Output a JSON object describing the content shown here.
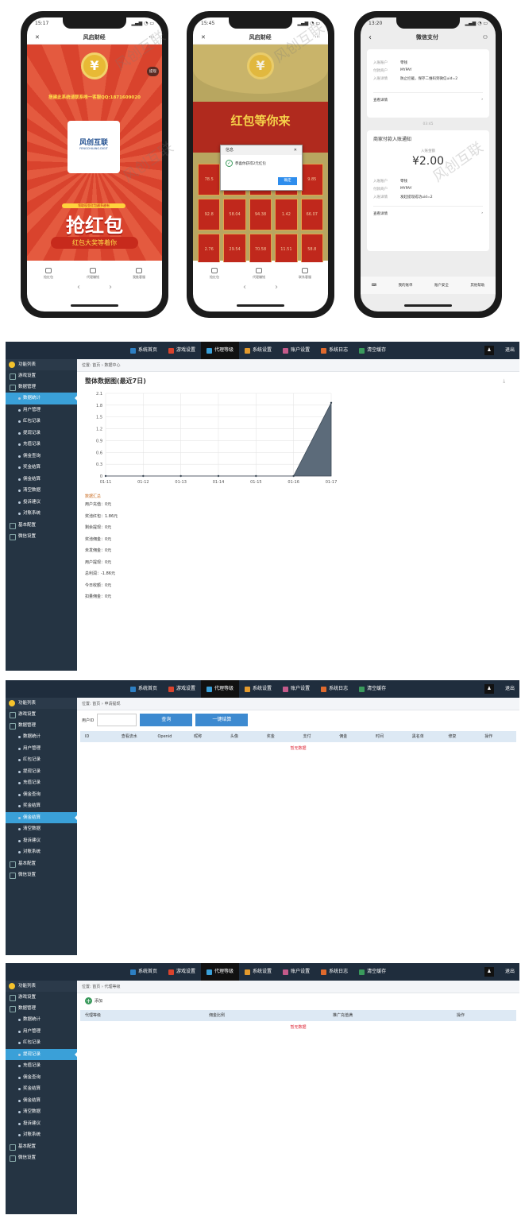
{
  "watermark": "风创互联",
  "phone1": {
    "time": "15:17",
    "title": "风启财经",
    "close": "✕",
    "more": "···",
    "coin": "¥",
    "withdraw_badge": "提现",
    "contact": "搭建此系统请联系唯一客服QQ:1871609020",
    "logo_main": "风创互联",
    "logo_sub": "FENGCHUANG.DIGIT",
    "banner_top": "领取现金红包越多越有",
    "banner_main": "抢红包",
    "banner_sub": "红包大奖等着你",
    "nav": [
      "抢红包",
      "代理赚钱",
      "我推客服"
    ]
  },
  "phone2": {
    "time": "15:45",
    "title": "风启财经",
    "close": "✕",
    "more": "···",
    "coin": "¥",
    "slogan": "红包等你来",
    "modal_title": "信息",
    "modal_close": "✕",
    "modal_text": "恭喜你获得2元红包",
    "modal_ok": "确定",
    "grid": [
      "78.5",
      "",
      "",
      "",
      "9.85",
      "92.8",
      "58.04",
      "94.38",
      "1.42",
      "66.07",
      "2.76",
      "29.54",
      "70.58",
      "11.51",
      "58.8"
    ],
    "nav": [
      "抢红包",
      "代理赚钱",
      "联系客服"
    ]
  },
  "phone3": {
    "time": "13:20",
    "title": "微信支付",
    "back": "‹",
    "r1": [
      [
        "入账账户",
        "零钱"
      ],
      [
        "付款商户",
        "MYPAY"
      ],
      [
        "入账详情",
        "防止拦截，保存二维码到微信uid=2"
      ]
    ],
    "detail": "查看详情",
    "stamp": "03:45",
    "card_title": "商家付款入账通知",
    "amount_label": "入账金额",
    "amount": "¥2.00",
    "r2": [
      [
        "入账账户",
        "零钱"
      ],
      [
        "付款商户",
        "MYPAY"
      ],
      [
        "入账详情",
        "发起提现成功uid=2"
      ]
    ],
    "bottom": [
      "我的账单",
      "账户安全",
      "其他帮助"
    ]
  },
  "admin_nav": [
    "系统首页",
    "游戏设置",
    "代理等级",
    "系统设置",
    "账户设置",
    "系统日志",
    "清空缓存"
  ],
  "logout": "退出",
  "sidebar": {
    "head": "功能列表",
    "g1": "游戏设置",
    "g2": "数据管理",
    "items": [
      "数据统计",
      "用户管理",
      "红包记录",
      "提现记录",
      "充值记录",
      "佣金查询",
      "奖金结算",
      "佣金结算",
      "清空数据",
      "投诉建议",
      "对账系统"
    ],
    "g3": "基本配置",
    "g4": "微信设置"
  },
  "panel1": {
    "crumb": [
      "位置:",
      "首页",
      "数据中心"
    ],
    "title": "整体数据图(最近7日)",
    "summary_title": "数据汇总",
    "stats": [
      "用户充值：0元",
      "奖池红包：1.86元",
      "剩余提现：0元",
      "奖池佣金：0元",
      "未发佣金：0元",
      "用户提现：0元",
      "总利润：-1.86元",
      "今日收额：0元",
      "扣量佣金：0元"
    ]
  },
  "panel2": {
    "crumb": [
      "位置:",
      "首页",
      "申请提现"
    ],
    "label": "用户ID",
    "query": "查询",
    "settle": "一键结算",
    "cols": [
      "ID",
      "查看流水",
      "Openid",
      "昵称",
      "头像",
      "奖金",
      "支付",
      "佣金",
      "时间",
      "黑名单",
      "修复",
      "操作"
    ],
    "empty": "暂无数据"
  },
  "panel3": {
    "crumb": [
      "位置:",
      "首页",
      "代理等级"
    ],
    "add": "添加",
    "cols": [
      "代理等级",
      "佣金比例",
      "推广充值满",
      "操作"
    ],
    "empty": "暂无数据"
  },
  "chart_data": {
    "type": "area",
    "title": "整体数据图(最近7日)",
    "categories": [
      "01-11",
      "01-12",
      "01-13",
      "01-14",
      "01-15",
      "01-16",
      "01-17"
    ],
    "values": [
      0,
      0,
      0,
      0,
      0,
      0,
      1.86
    ],
    "yticks": [
      "2.1",
      "1.8",
      "1.5",
      "1.2",
      "0.9",
      "0.6",
      "0.3",
      "0"
    ],
    "ylim": [
      0,
      2.1
    ],
    "color": "#5c6b7a"
  }
}
